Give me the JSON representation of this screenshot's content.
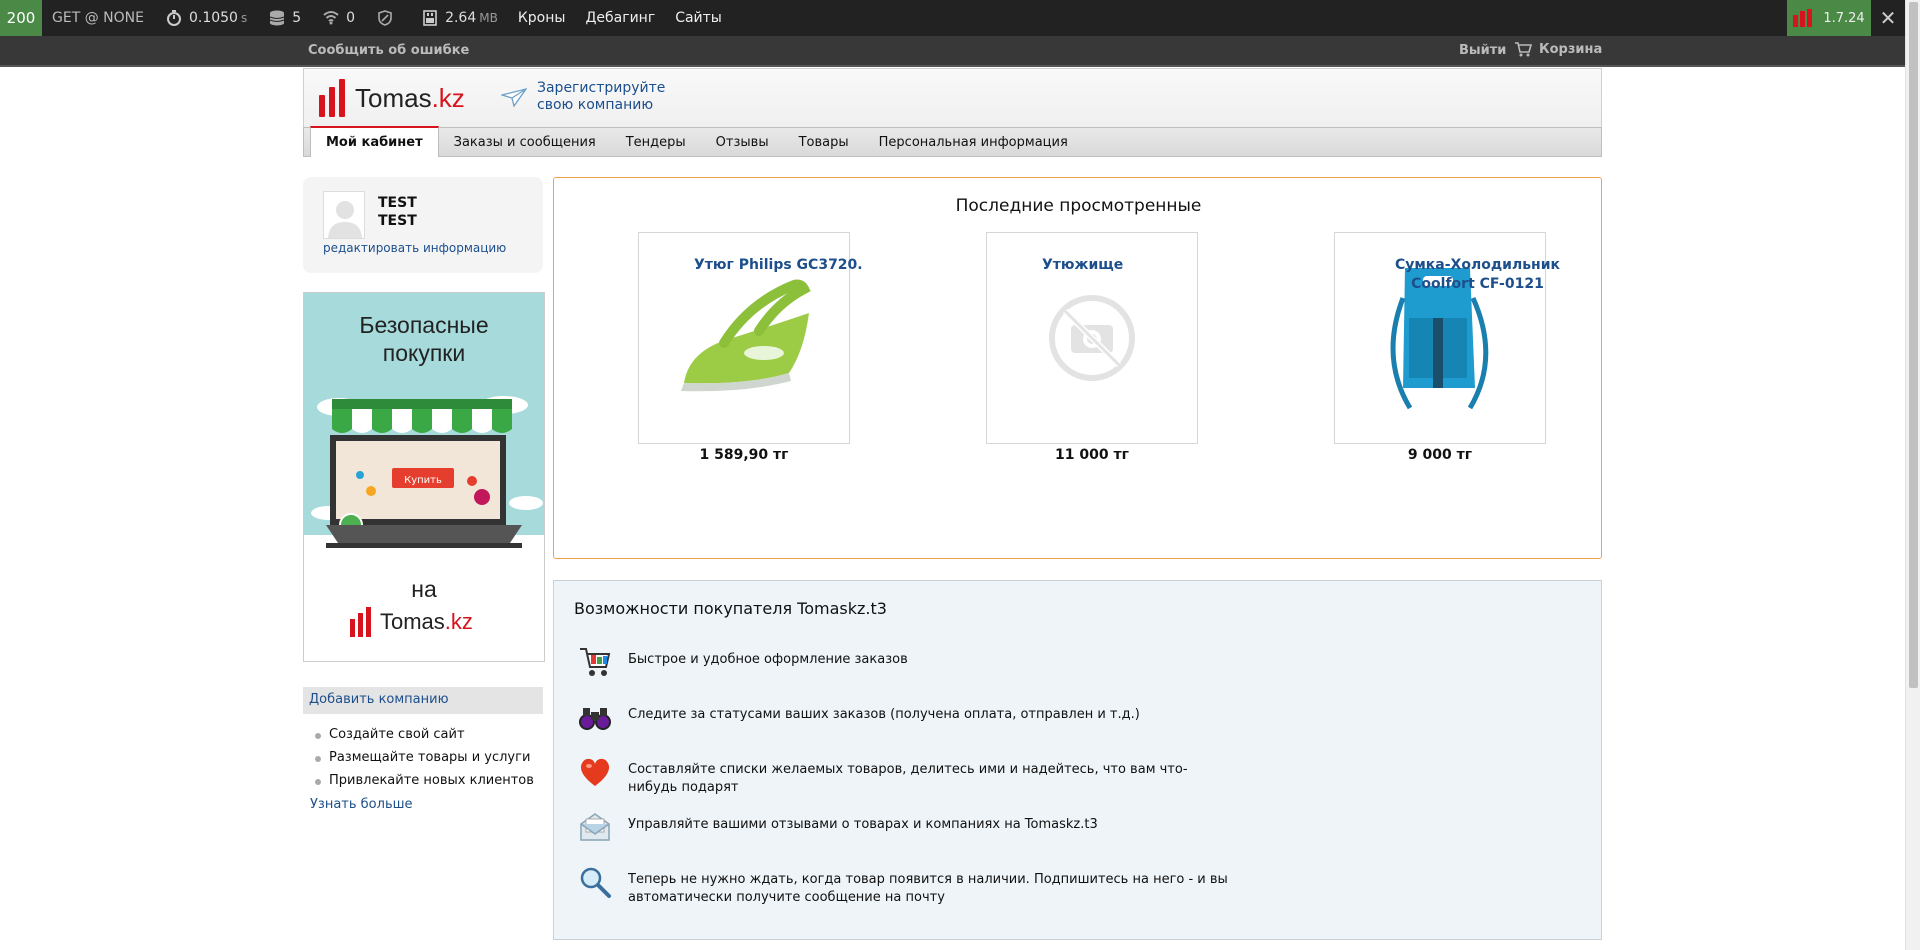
{
  "debug": {
    "status": "200",
    "request": "GET @ NONE",
    "time": "0.1050",
    "time_unit": "s",
    "db_queries": "5",
    "events": "0",
    "memory": "2.64",
    "memory_unit": "MB",
    "links": [
      "Кроны",
      "Дебагинг",
      "Сайты"
    ],
    "version": "1.7.24"
  },
  "topbar": {
    "report": "Сообщить об ошибке",
    "logout": "Выйти",
    "cart": "Корзина"
  },
  "header": {
    "logo_main": "Tomas",
    "logo_tld": ".kz",
    "register_line1": "Зарегистрируйте",
    "register_line2": "свою компанию"
  },
  "tabs": [
    "Мой кабинет",
    "Заказы и сообщения",
    "Тендеры",
    "Отзывы",
    "Товары",
    "Персональная информация"
  ],
  "profile": {
    "first": "TEST",
    "last": "TEST",
    "edit": "редактировать информацию"
  },
  "promo": {
    "title_line1": "Безопасные",
    "title_line2": "покупки",
    "buy": "Купить",
    "na": "на",
    "logo_main": "Tomas",
    "logo_tld": ".kz"
  },
  "company": {
    "add": "Добавить компанию",
    "benefits": [
      "Создайте свой сайт",
      "Размещайте товары и услуги",
      "Привлекайте новых клиентов"
    ],
    "more": "Узнать больше"
  },
  "recent": {
    "title": "Последние просмотренные",
    "items": [
      {
        "name": "Утюг Philips GC3720.",
        "price": "1 589,90 тг"
      },
      {
        "name": "Утюжище",
        "price": "11 000 тг"
      },
      {
        "name": "Сумка-Холодильник Coolfort CF-0121",
        "price": "9 000 тг"
      }
    ]
  },
  "features": {
    "title": "Возможности покупателя Tomaskz.t3",
    "items": [
      {
        "icon": "cart-icon",
        "text": "Быстрое и удобное оформление заказов"
      },
      {
        "icon": "binoculars-icon",
        "text": "Следите за статусами ваших заказов (получена оплата, отправлен и т.д.)"
      },
      {
        "icon": "heart-icon",
        "text": "Составляйте списки желаемых товаров, делитесь ими и надейтесь, что вам что-нибудь подарят"
      },
      {
        "icon": "envelope-icon",
        "text": "Управляйте вашими отзывами о товарах и компаниях на Tomaskz.t3"
      },
      {
        "icon": "magnifier-icon",
        "text": "Теперь не нужно ждать, когда товар появится в наличии. Подпишитесь на него - и вы автоматически получите сообщение на почту"
      }
    ]
  },
  "colors": {
    "brand_red": "#d7141d",
    "link_blue": "#1d4f8c",
    "recent_border": "#f2a24f",
    "debug_green": "#4a8a46"
  }
}
